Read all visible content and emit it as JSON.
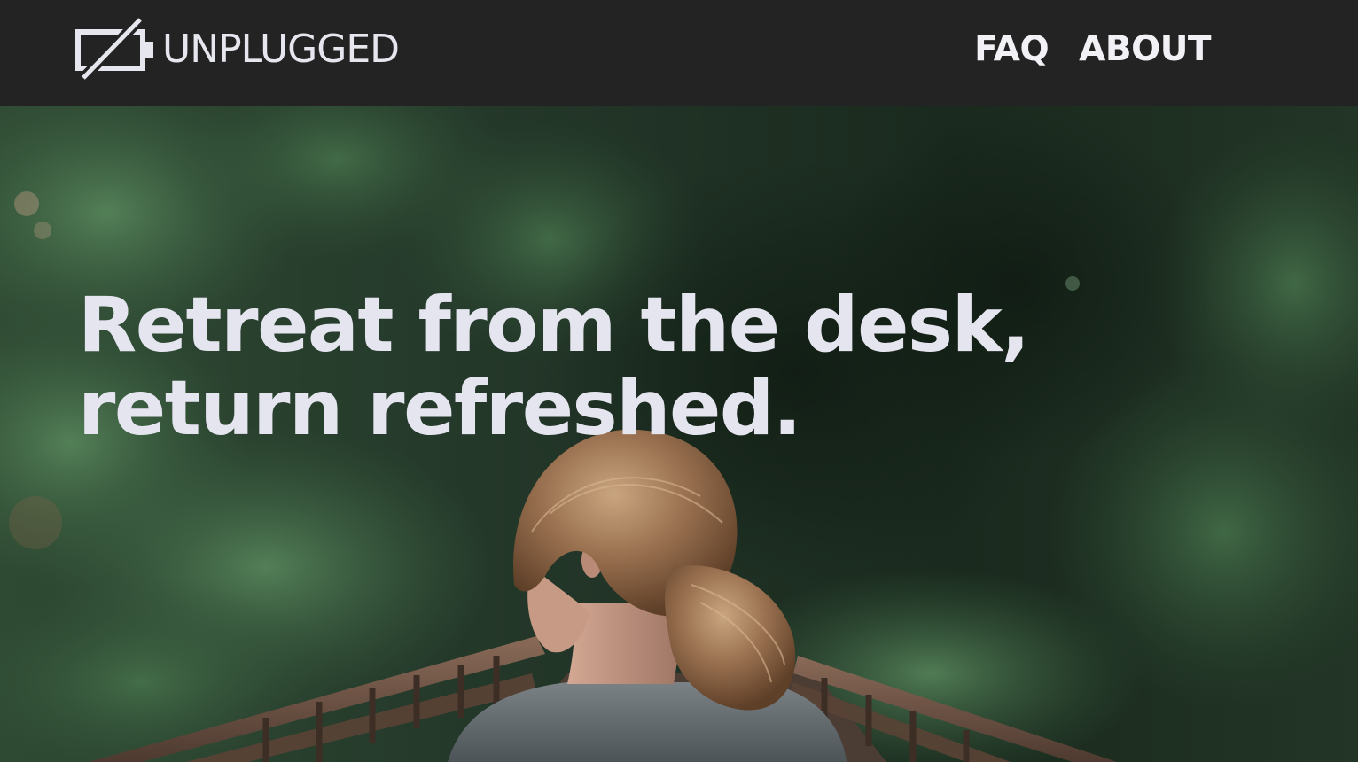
{
  "navbar": {
    "brand": {
      "icon": "unplugged-battery-icon",
      "name": "UNPLUGGED"
    },
    "links": [
      {
        "label": "FAQ"
      },
      {
        "label": "ABOUT"
      }
    ]
  },
  "hero": {
    "headline_line1": "Retreat from the desk,",
    "headline_line2": "return refreshed.",
    "photo_subject": "woman-on-forest-bridge-image"
  },
  "colors": {
    "navbar_bg": "#232323",
    "text_light": "#e5e5ef",
    "forest_dark": "#1b2a1f",
    "forest_green": "#3f6a45"
  }
}
